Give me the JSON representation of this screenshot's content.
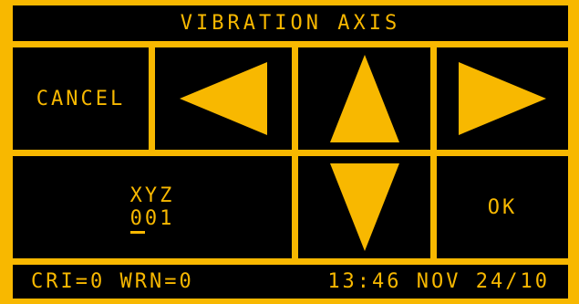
{
  "header": {
    "title": "VIBRATION AXIS"
  },
  "buttons": {
    "cancel_label": "CANCEL",
    "ok_label": "OK",
    "left_icon": "triangle-left-icon",
    "up_icon": "triangle-up-icon",
    "right_icon": "triangle-right-icon",
    "down_icon": "triangle-down-icon"
  },
  "axis": {
    "name": "XYZ",
    "value": "001",
    "cursor_position": 1
  },
  "status_bar": {
    "alarms": "CRI=0 WRN=0",
    "datetime": "13:46 NOV 24/10"
  },
  "colors": {
    "foreground": "#f8b800",
    "background": "#000000"
  }
}
